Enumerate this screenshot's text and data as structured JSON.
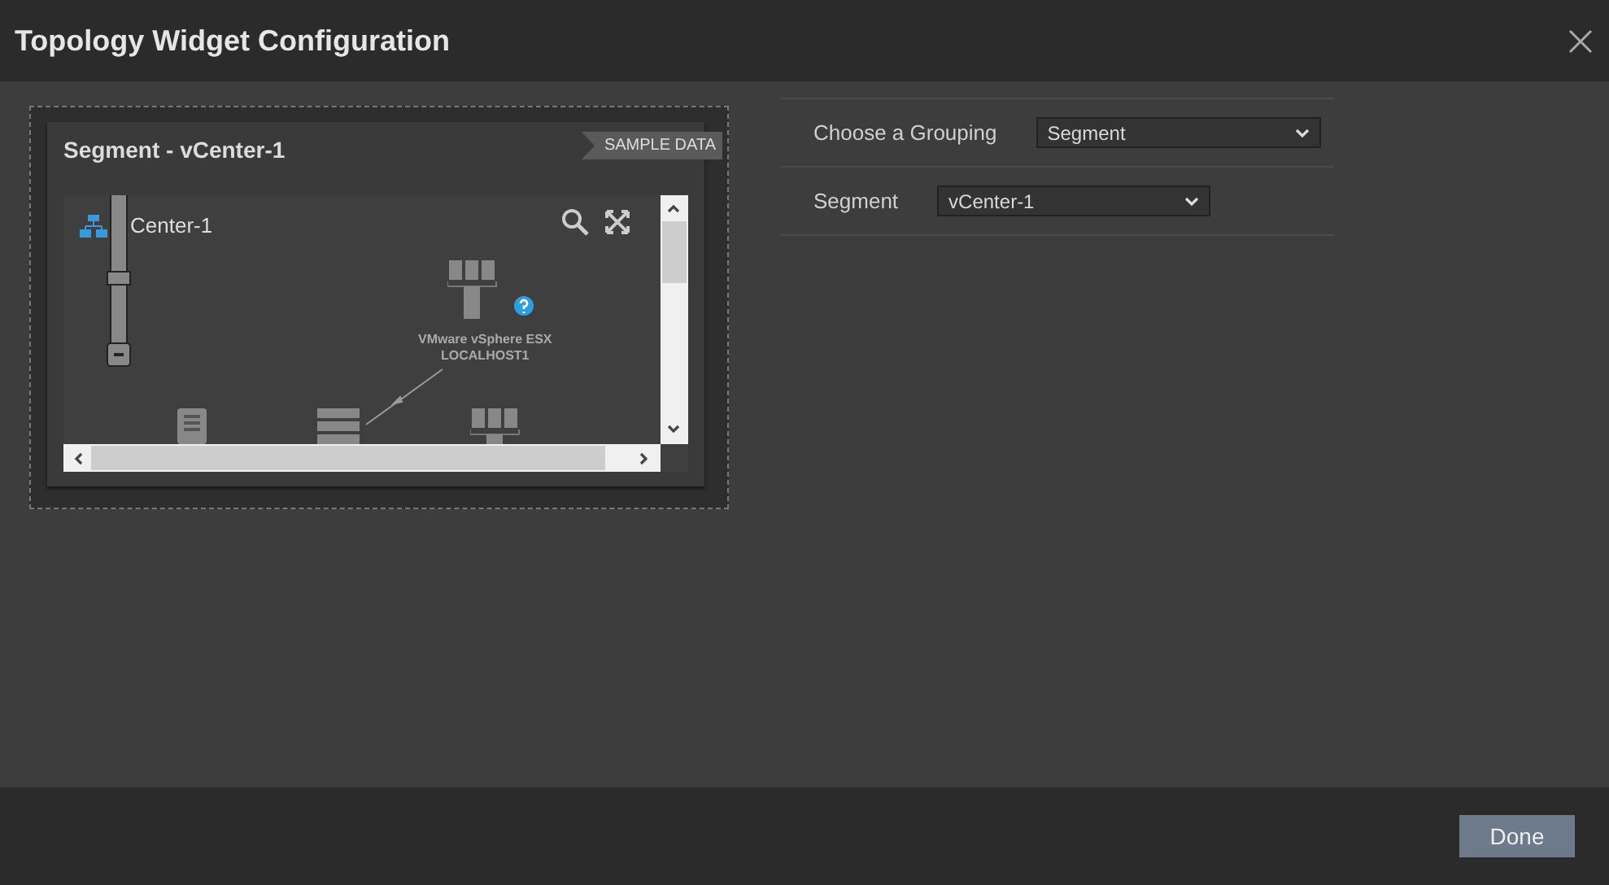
{
  "window": {
    "title": "Topology Widget Configuration"
  },
  "preview": {
    "title": "Segment - vCenter-1",
    "ribbon": "SAMPLE DATA",
    "root_label": "Center-1",
    "zoom": {
      "level": 0.5
    },
    "nodes": [
      {
        "kind": "host",
        "lines": [
          "VMware vSphere ESX",
          "LOCALHOST1"
        ]
      }
    ]
  },
  "settings": [
    {
      "label": "Choose a Grouping",
      "value": "Segment"
    },
    {
      "label": "Segment",
      "value": "vCenter-1"
    }
  ],
  "buttons": [
    "Done"
  ]
}
